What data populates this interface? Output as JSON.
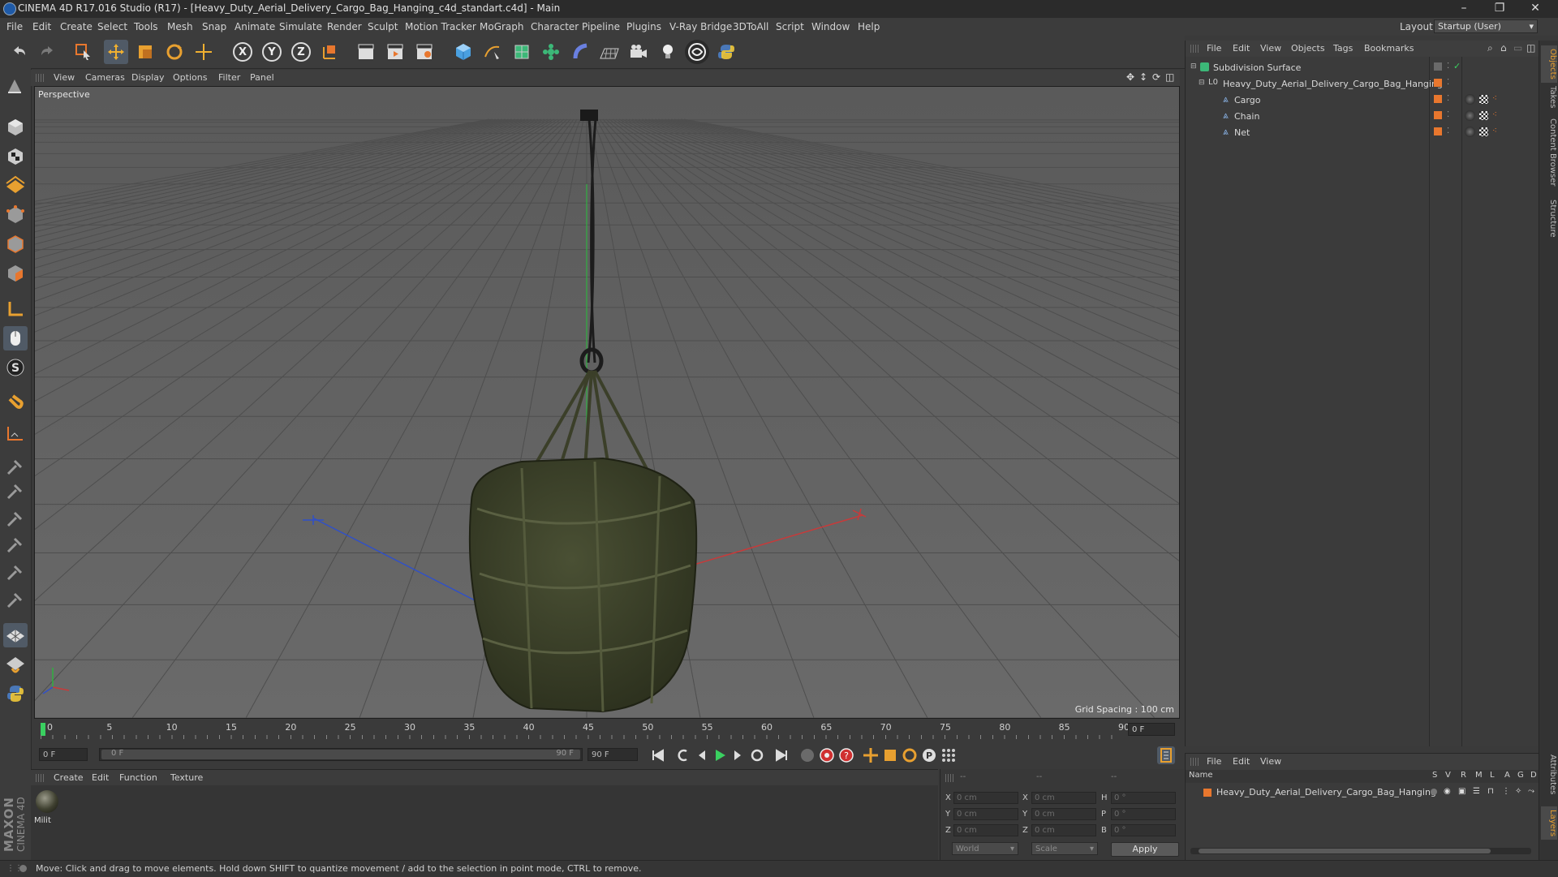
{
  "window": {
    "title": "CINEMA 4D R17.016 Studio (R17) - [Heavy_Duty_Aerial_Delivery_Cargo_Bag_Hanging_c4d_standart.c4d] - Main",
    "minimize": "–",
    "restore": "❐",
    "close": "✕"
  },
  "menu": [
    "File",
    "Edit",
    "Create",
    "Select",
    "Tools",
    "Mesh",
    "Snap",
    "Animate",
    "Simulate",
    "Render",
    "Sculpt",
    "Motion Tracker",
    "MoGraph",
    "Character",
    "Pipeline",
    "Plugins",
    "V-Ray Bridge",
    "3DToAll",
    "Script",
    "Window",
    "Help"
  ],
  "layout": {
    "label": "Layout:",
    "value": "Startup (User)"
  },
  "toolbar": {
    "axis_x": "X",
    "axis_y": "Y",
    "axis_z": "Z"
  },
  "viewport": {
    "menu": [
      "View",
      "Cameras",
      "Display",
      "Options",
      "Filter",
      "Panel"
    ],
    "label": "Perspective",
    "grid_spacing": "Grid Spacing : 100 cm"
  },
  "timeline": {
    "ticks": [
      "0",
      "5",
      "10",
      "15",
      "20",
      "25",
      "30",
      "35",
      "40",
      "45",
      "50",
      "55",
      "60",
      "65",
      "70",
      "75",
      "80",
      "85",
      "90"
    ],
    "current_frame": "0 F",
    "start_field": "0 F",
    "range_start": "0 F",
    "range_end": "90 F",
    "end_field": "90 F"
  },
  "materials": {
    "menu": [
      "Create",
      "Edit",
      "Function",
      "Texture"
    ],
    "items": [
      {
        "name": "Milit"
      }
    ]
  },
  "coords": {
    "header_a": "--",
    "header_b": "--",
    "header_c": "--",
    "rows": [
      {
        "l1": "X",
        "v1": "0 cm",
        "l2": "X",
        "v2": "0 cm",
        "l3": "H",
        "v3": "0 °"
      },
      {
        "l1": "Y",
        "v1": "0 cm",
        "l2": "Y",
        "v2": "0 cm",
        "l3": "P",
        "v3": "0 °"
      },
      {
        "l1": "Z",
        "v1": "0 cm",
        "l2": "Z",
        "v2": "0 cm",
        "l3": "B",
        "v3": "0 °"
      }
    ],
    "space": "World",
    "mode": "Scale",
    "apply": "Apply"
  },
  "objects": {
    "menu": [
      "File",
      "Edit",
      "View",
      "Objects",
      "Tags",
      "Bookmarks"
    ],
    "tree": [
      {
        "name": "Subdivision Surface",
        "level": 0
      },
      {
        "name": "Heavy_Duty_Aerial_Delivery_Cargo_Bag_Hanging",
        "level": 1
      },
      {
        "name": "Cargo",
        "level": 2
      },
      {
        "name": "Chain",
        "level": 2
      },
      {
        "name": "Net",
        "level": 2
      }
    ]
  },
  "layers": {
    "menu": [
      "File",
      "Edit",
      "View"
    ],
    "columns": [
      "Name",
      "S",
      "V",
      "R",
      "M",
      "L",
      "A",
      "G",
      "D"
    ],
    "rows": [
      {
        "name": "Heavy_Duty_Aerial_Delivery_Cargo_Bag_Hanging"
      }
    ]
  },
  "right_tabs": [
    "Objects",
    "Takes",
    "Content Browser",
    "Structure",
    "Attributes",
    "Layers"
  ],
  "status": "Move: Click and drag to move elements. Hold down SHIFT to quantize movement / add to the selection in point mode, CTRL to remove.",
  "logo": {
    "line1": "MAXON",
    "line2": "CINEMA 4D"
  },
  "colors": {
    "accent_orange": "#e8772e",
    "x_axis": "#d04040",
    "y_axis": "#40c040",
    "z_axis": "#4060d0",
    "cargo": "#3d4229"
  }
}
